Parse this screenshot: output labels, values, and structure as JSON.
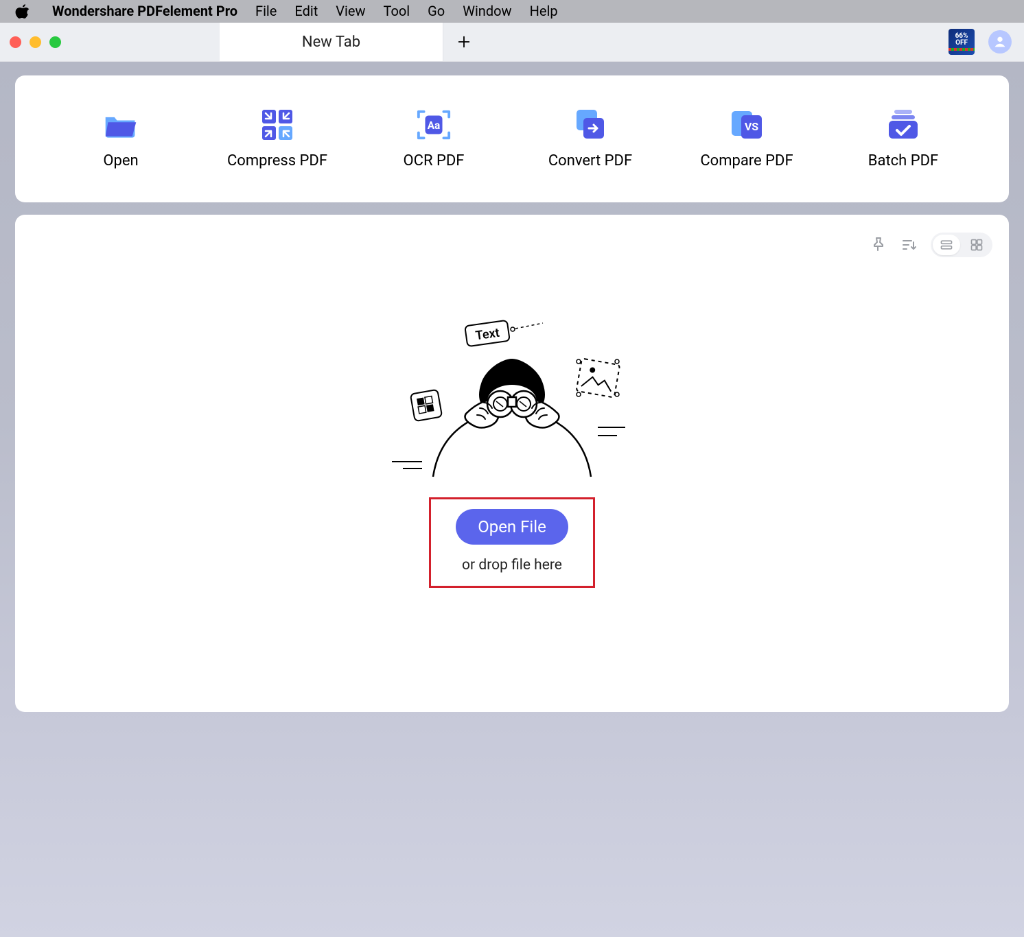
{
  "menubar": {
    "app_name": "Wondershare PDFelement Pro",
    "items": [
      "File",
      "Edit",
      "View",
      "Tool",
      "Go",
      "Window",
      "Help"
    ]
  },
  "tabbar": {
    "tab_label": "New Tab",
    "promo": {
      "line1": "66%",
      "line2": "OFF"
    }
  },
  "tools": {
    "open": "Open",
    "compress": "Compress PDF",
    "ocr": "OCR PDF",
    "convert": "Convert PDF",
    "compare": "Compare PDF",
    "batch": "Batch PDF"
  },
  "main": {
    "open_file_label": "Open File",
    "drop_hint": "or drop file here"
  },
  "colors": {
    "accent": "#5b65ec",
    "icon_solid": "#4f58e6",
    "icon_light": "#66a8ff"
  }
}
